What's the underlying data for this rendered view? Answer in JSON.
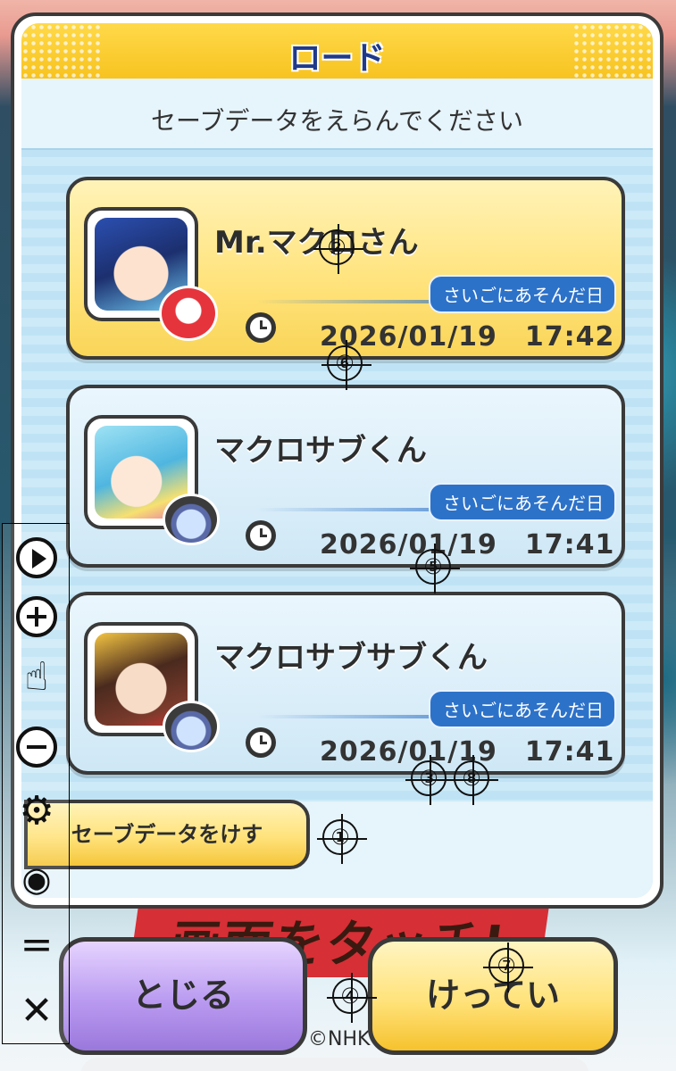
{
  "dialog": {
    "title": "ロード",
    "subtitle": "セーブデータをえらんでください"
  },
  "saves": [
    {
      "name": "Mr.マクロさん",
      "last_played_label": "さいごにあそんだ日",
      "datetime": "2026/01/19　17:42",
      "selected": true
    },
    {
      "name": "マクロサブくん",
      "last_played_label": "さいごにあそんだ日",
      "datetime": "2026/01/19　17:41",
      "selected": false
    },
    {
      "name": "マクロサブサブくん",
      "last_played_label": "さいごにあそんだ日",
      "datetime": "2026/01/19　17:41",
      "selected": false
    }
  ],
  "buttons": {
    "delete_save": "セーブデータをけす",
    "close": "とじる",
    "confirm": "けってい"
  },
  "toolbar": {
    "icons": [
      "play-icon",
      "plus-icon",
      "hand-pointer-icon",
      "minus-icon",
      "gear-icon",
      "eye-off-icon",
      "equals-icon",
      "close-icon"
    ]
  },
  "markers": [
    "①",
    "②",
    "③",
    "④",
    "⑤",
    "⑥",
    "⑦",
    "⑧"
  ],
  "background": {
    "banner_text": "画面をタッチ!",
    "copyright": "©NHK"
  },
  "colors": {
    "selected_slot": "#ffe27a",
    "normal_slot": "#cfe8f6",
    "title_bar": "#f7c320",
    "title_text": "#1f3a8a",
    "last_played_pill": "#2d72c9",
    "close_button": "#b99af0",
    "confirm_button": "#ffe27a"
  }
}
